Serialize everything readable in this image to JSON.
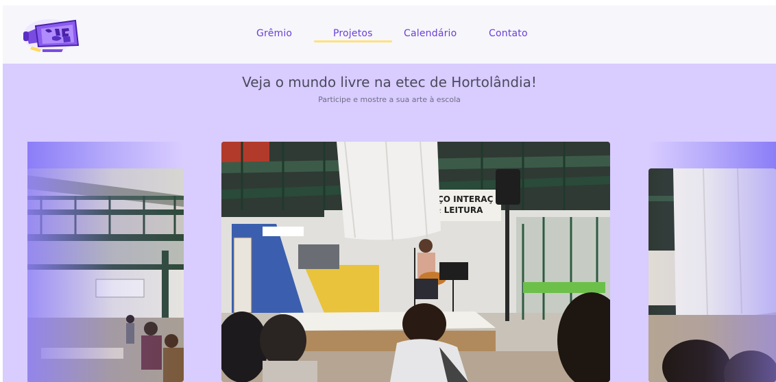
{
  "logo": {
    "text": "DAME SY",
    "icon": "megaphone-icon"
  },
  "nav": {
    "items": [
      {
        "label": "Grêmio"
      },
      {
        "label": "Projetos",
        "active": true
      },
      {
        "label": "Calendário"
      },
      {
        "label": "Contato"
      }
    ],
    "active_underline_color": "#ffe27a",
    "link_color": "#6b3fd6"
  },
  "hero": {
    "title": "Veja o mundo livre na etec de Hortolândia!",
    "subtitle": "Participe e mostre a sua arte à escola"
  },
  "carousel": {
    "slides": [
      {
        "name": "slide-left"
      },
      {
        "name": "slide-main",
        "sign_line1": "PAÇO INTERAÇ",
        "sign_line2": "& LEITURA"
      },
      {
        "name": "slide-right"
      }
    ]
  },
  "colors": {
    "page_background": "#d9ccff",
    "header_background": "#f6f6fb",
    "brand_purple": "#6b3fd6"
  }
}
